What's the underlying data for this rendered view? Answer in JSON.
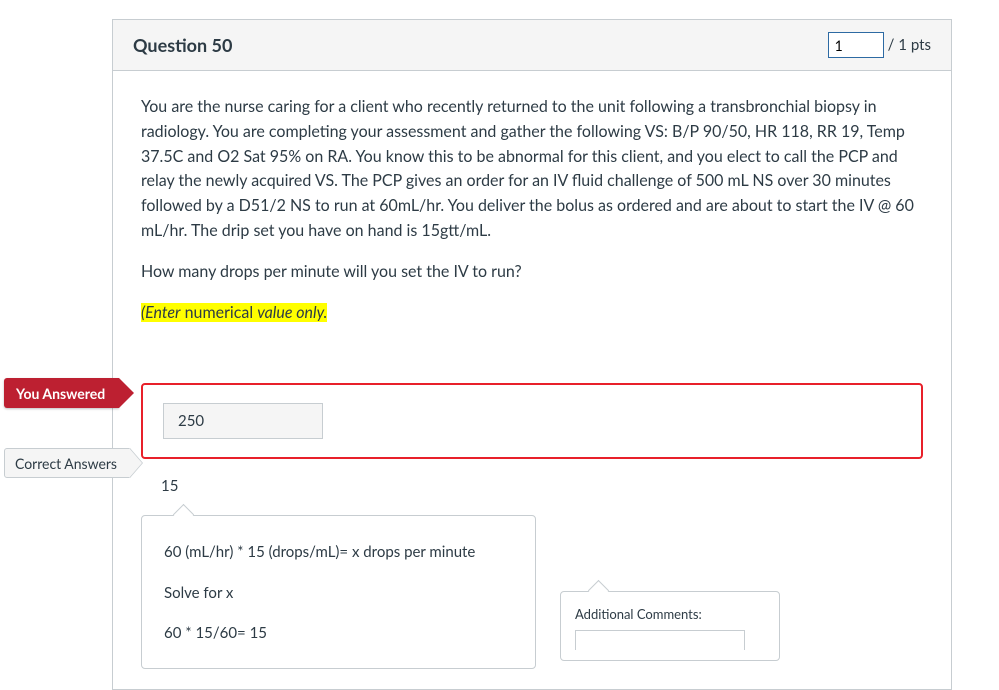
{
  "question": {
    "title": "Question 50",
    "points_value": "1",
    "points_suffix": "/ 1 pts",
    "paragraph1": "You are the nurse caring for a client who recently returned to the unit following a transbronchial biopsy in radiology. You are completing your assessment and gather the following VS: B/P 90/50, HR 118, RR 19, Temp 37.5C and O2 Sat 95% on RA. You know this to be abnormal for this client, and you elect to call the PCP and relay the newly acquired VS. The PCP gives an order for an IV fluid challenge of 500 mL NS over 30 minutes followed by a D51/2 NS to run at 60mL/hr.  You deliver the bolus as ordered and are about to start the  IV @ 60 mL/hr.  The drip set you have on hand is 15gtt/mL.",
    "paragraph2": "How many drops per minute will you set the IV to run?",
    "hint_italic_a": "(Enter",
    "hint_plain": " numerical ",
    "hint_italic_b": "value only."
  },
  "flags": {
    "you_answered": "You Answered",
    "correct_answers": "Correct Answers"
  },
  "answers": {
    "student_answer": "250",
    "correct_answer": "15"
  },
  "explanation": {
    "line1": "60 (mL/hr) * 15 (drops/mL)= x drops per minute",
    "line2": "Solve for x",
    "line3": "60 * 15/60= 15"
  },
  "comments": {
    "label": "Additional Comments:"
  }
}
